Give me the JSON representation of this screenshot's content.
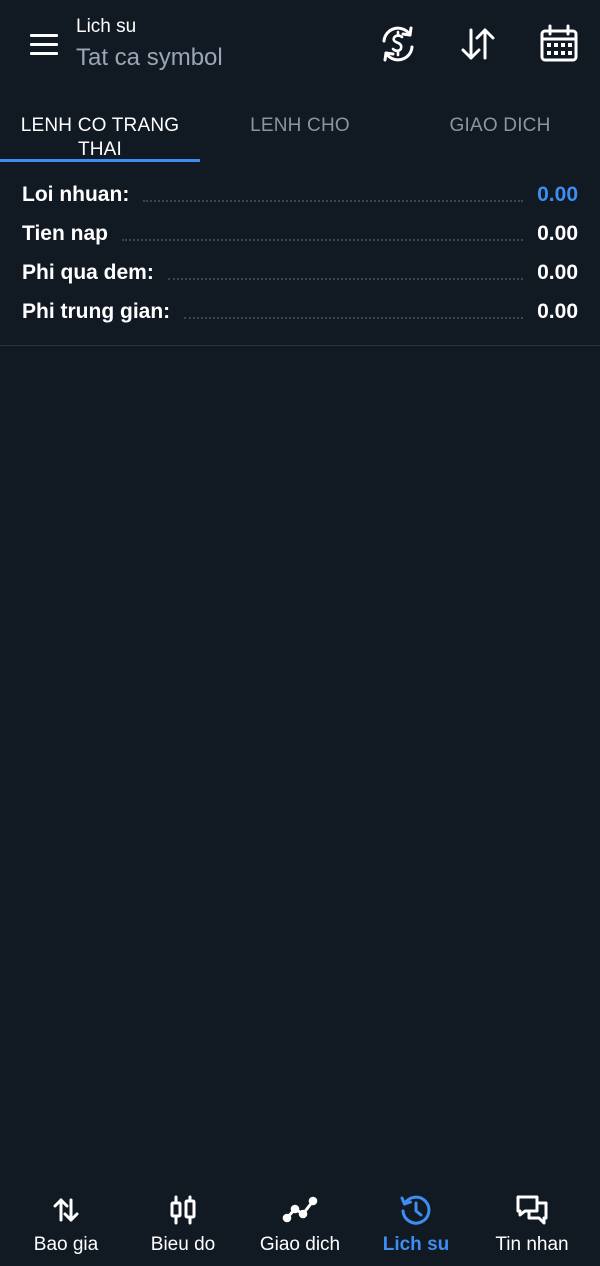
{
  "header": {
    "subtitle": "Lich su",
    "title": "Tat ca symbol",
    "icons": [
      "menu-icon",
      "currency-refresh-icon",
      "sort-icon",
      "calendar-icon"
    ]
  },
  "tabs": [
    {
      "label": "LENH CO TRANG THAI",
      "active": true
    },
    {
      "label": "LENH CHO",
      "active": false
    },
    {
      "label": "GIAO DICH",
      "active": false
    }
  ],
  "summary": {
    "rows": [
      {
        "label": "Loi nhuan:",
        "value": "0.00"
      },
      {
        "label": "Tien nap",
        "value": "0.00"
      },
      {
        "label": "Phi qua dem:",
        "value": "0.00"
      },
      {
        "label": "Phi trung gian:",
        "value": "0.00"
      }
    ]
  },
  "nav": {
    "items": [
      {
        "label": "Bao gia",
        "icon": "arrows-up-down-icon",
        "active": false
      },
      {
        "label": "Bieu do",
        "icon": "candlestick-icon",
        "active": false
      },
      {
        "label": "Giao dich",
        "icon": "trend-line-icon",
        "active": false
      },
      {
        "label": "Lich su",
        "icon": "history-icon",
        "active": true
      },
      {
        "label": "Tin nhan",
        "icon": "chat-icon",
        "active": false
      }
    ]
  },
  "colors": {
    "background": "#111923",
    "accent": "#3d8ef0",
    "muted_text": "#9aa6b5"
  }
}
